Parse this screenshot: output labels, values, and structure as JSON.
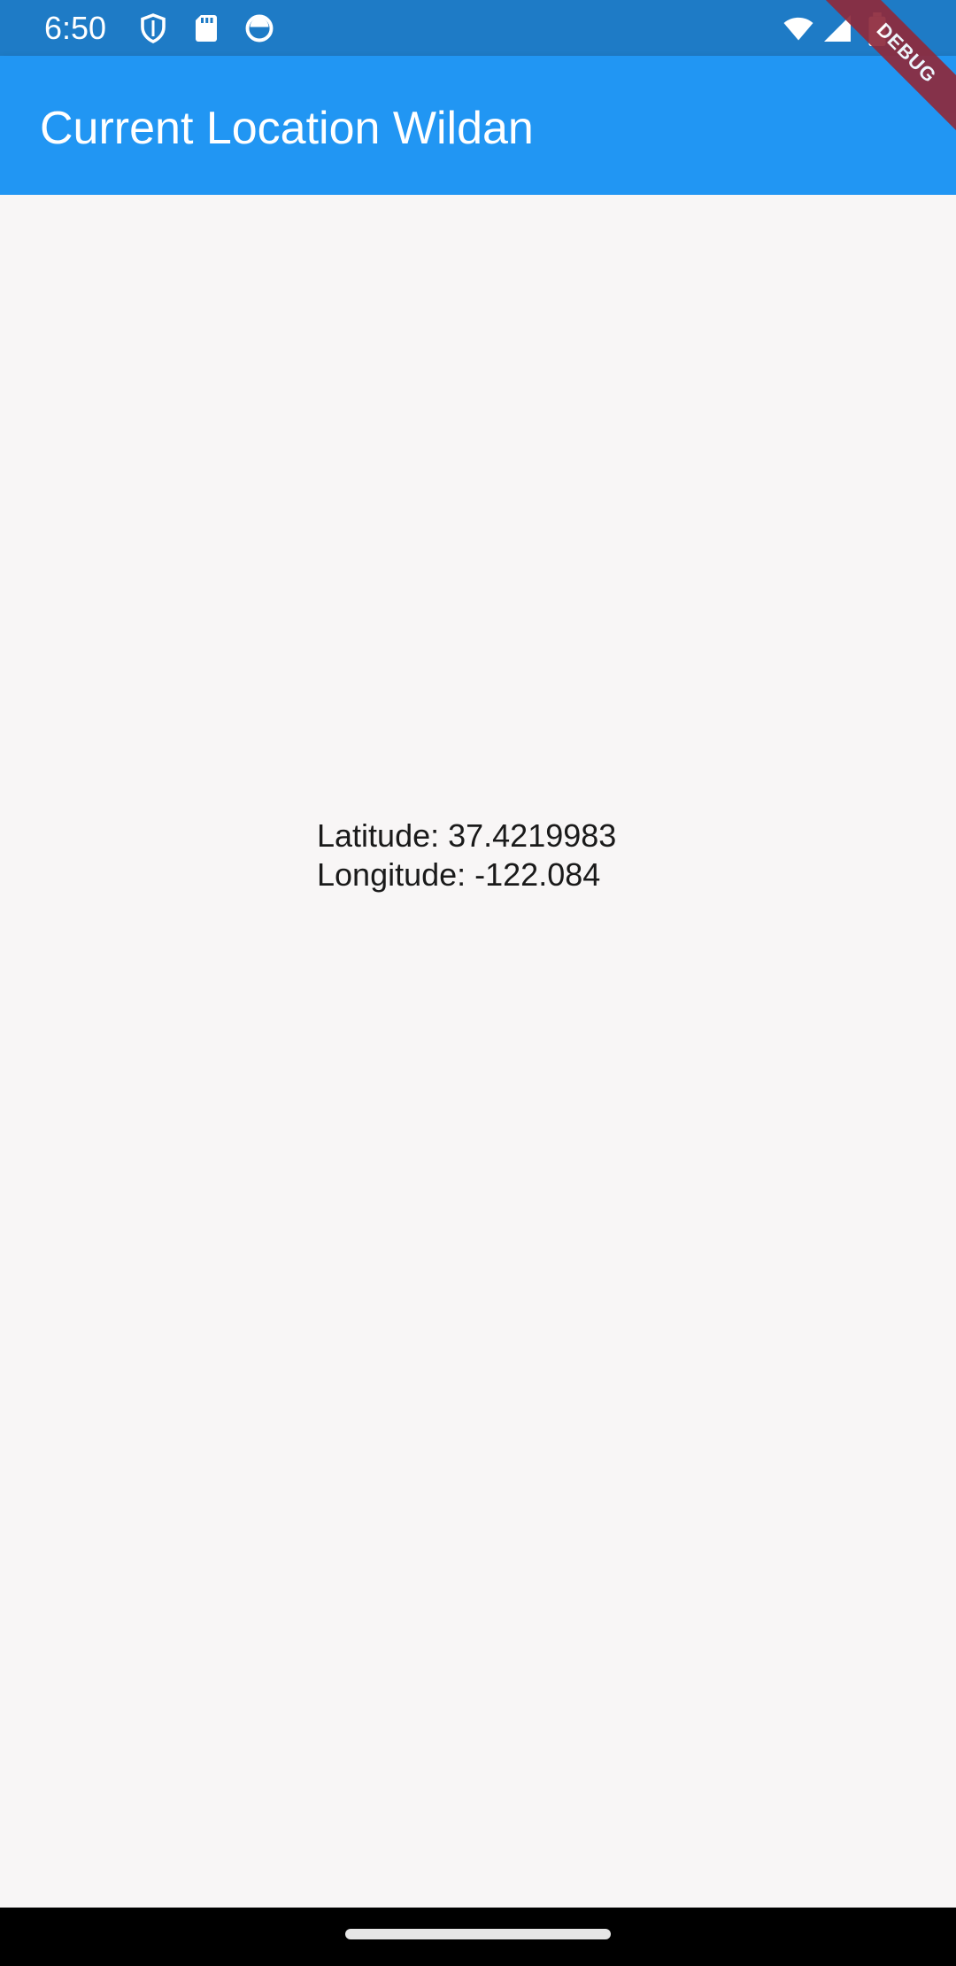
{
  "status_bar": {
    "time": "6:50",
    "icons": [
      "shield-icon",
      "sd-card-icon",
      "app-notification-icon",
      "wifi-icon",
      "signal-icon",
      "battery-icon"
    ]
  },
  "app_bar": {
    "title": "Current Location Wildan"
  },
  "debug_banner": {
    "label": "DEBUG"
  },
  "location": {
    "latitude": "Latitude: 37.4219983",
    "longitude": "Longitude: -122.084"
  },
  "colors": {
    "status_bar": "#1e7bc6",
    "app_bar": "#2196f3",
    "background": "#f8f6f6",
    "debug_ribbon": "#8e2a3c"
  }
}
